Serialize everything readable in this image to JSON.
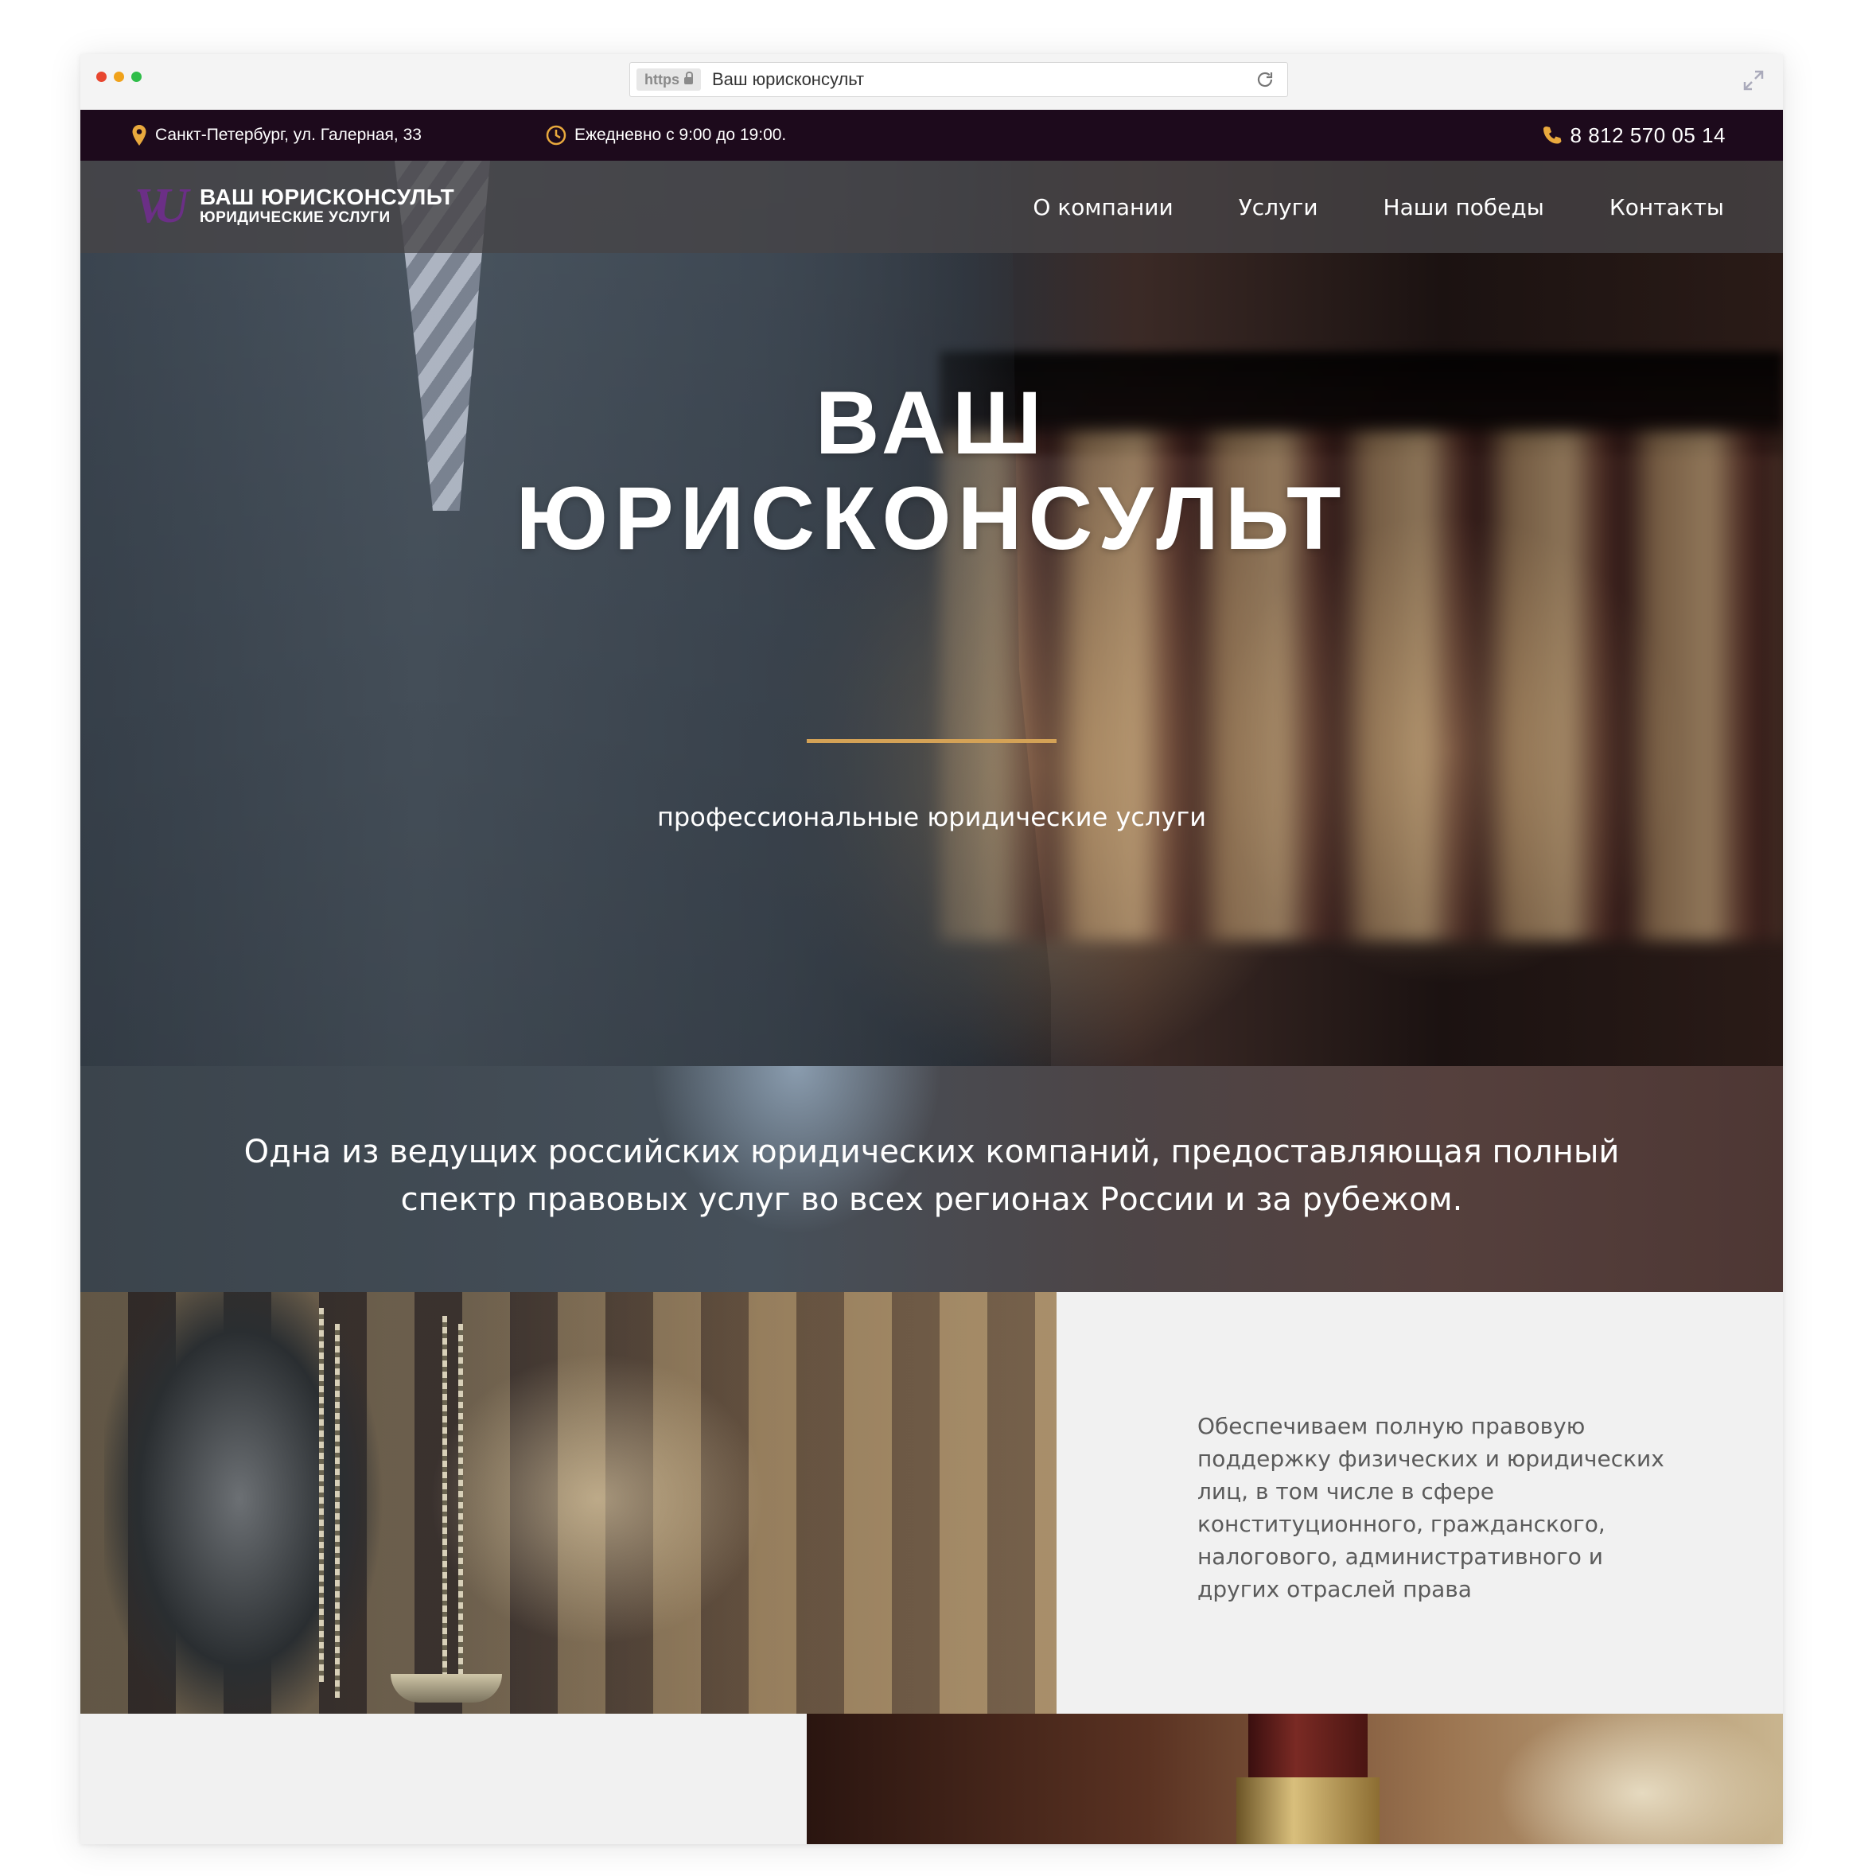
{
  "browser": {
    "scheme": "https",
    "title": "Ваш юрисконсульт"
  },
  "topbar": {
    "address": "Санкт-Петербург, ул. Галерная, 33",
    "hours": "Ежедневно с 9:00 до 19:00.",
    "phone": "8 812 570 05 14"
  },
  "logo": {
    "mark": "VU",
    "title": "ВАШ ЮРИСКОНСУЛЬТ",
    "subtitle": "ЮРИДИЧЕСКИЕ УСЛУГИ"
  },
  "nav": {
    "items": [
      {
        "label": "О компании"
      },
      {
        "label": "Услуги"
      },
      {
        "label": "Наши победы"
      },
      {
        "label": "Контакты"
      }
    ]
  },
  "hero": {
    "title_line1": "ВАШ",
    "title_line2": "ЮРИСКОНСУЛЬТ",
    "subtitle": "профессиональные юридические услуги"
  },
  "intro": {
    "text": "Одна из ведущих российских юридических компаний, предоставляющая полный спектр правовых услуг во всех регионах России и за рубежом."
  },
  "services": {
    "text": "Обеспечиваем полную правовую поддержку физических и юридических лиц, в том числе в сфере конституционного, гражданского, налогового, административного и других отраслей права"
  },
  "colors": {
    "topbar_bg": "#1d0a1c",
    "accent_gold": "#d4a256",
    "logo_purple": "#6b2f86"
  },
  "icons": {
    "address": "map-pin-icon",
    "hours": "clock-icon",
    "phone": "phone-icon",
    "reload": "reload-icon",
    "expand": "expand-icon"
  }
}
